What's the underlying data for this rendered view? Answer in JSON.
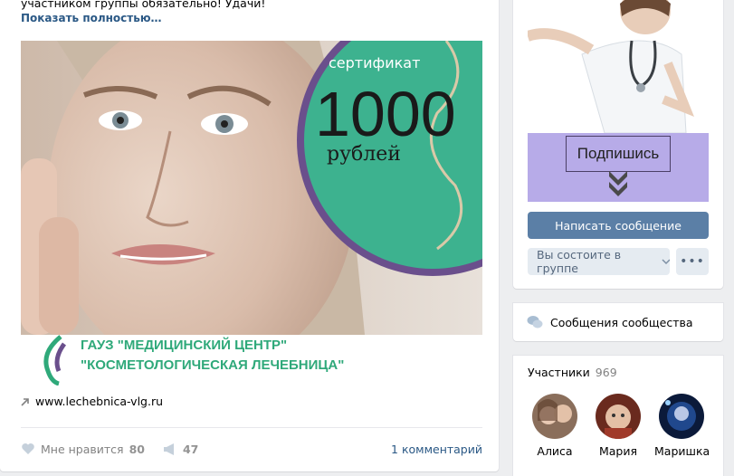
{
  "post": {
    "text_line": "участником группы обязательно! Удачи!",
    "show_more": "Показать полностью…",
    "banner": {
      "cert_word": "сертификат",
      "cert_amount": "1000",
      "cert_currency": "рублей",
      "org_line1": "ГАУЗ \"МЕДИЦИНСКИЙ ЦЕНТР\"",
      "org_line2": "\"КОСМЕТОЛОГИЧЕСКАЯ ЛЕЧЕБНИЦА\""
    },
    "link": "www.lechebnica-vlg.ru",
    "likes_label": "Мне нравится",
    "likes_count": "80",
    "shares_count": "47",
    "comments_label": "1 комментарий"
  },
  "sidebar": {
    "subscribe_label": "Подпишись",
    "write_message": "Написать сообщение",
    "member_status": "Вы состоите в группе",
    "more_label": "•••",
    "community_messages": "Сообщения сообщества",
    "members_title": "Участники",
    "members_count": "969",
    "members": [
      {
        "name": "Алиса"
      },
      {
        "name": "Мария"
      },
      {
        "name": "Маришка"
      }
    ]
  },
  "colors": {
    "link": "#2a5885",
    "primary_button": "#5b7fa6",
    "secondary_button": "#e5ebf1",
    "teal_circle": "#3db28f",
    "purple_ring": "#6a4f8c",
    "subscribe_bg": "#b7abe8"
  }
}
